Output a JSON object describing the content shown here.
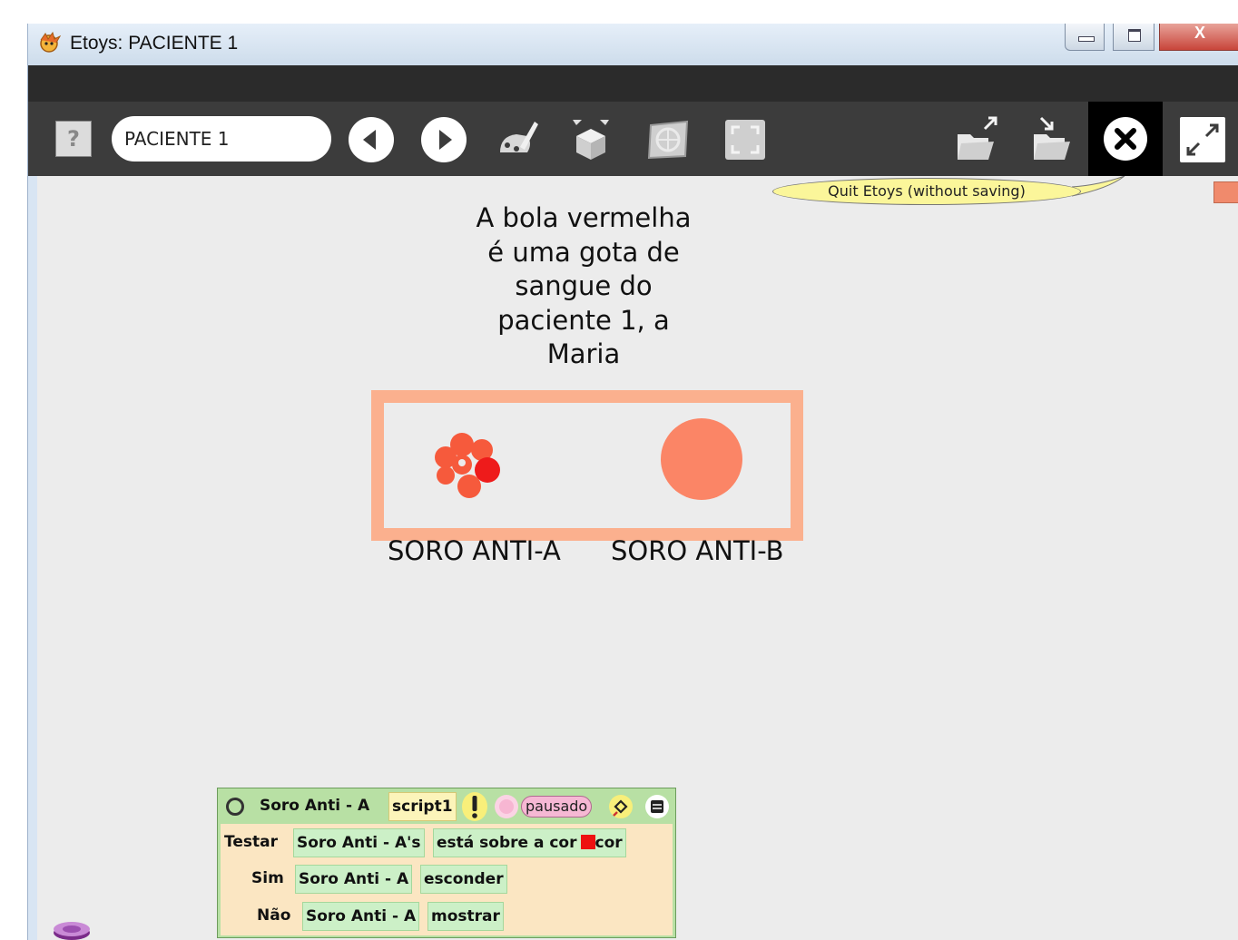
{
  "window": {
    "title": "Etoys: PACIENTE 1",
    "close_glyph": "X"
  },
  "toolbar": {
    "help_label": "?",
    "project_name": "PACIENTE 1",
    "icons": [
      "help-icon",
      "previous-page-icon",
      "next-page-icon",
      "paint-icon",
      "supplies-icon",
      "language-icon",
      "fullscreen-icon",
      "save-project-icon",
      "load-project-icon",
      "quit-icon",
      "zoom-icon"
    ]
  },
  "world": {
    "tooltip": "Quit Etoys (without saving)",
    "description": [
      "A bola vermelha",
      "é uma gota de",
      "sangue do",
      "paciente 1, a",
      "Maria"
    ],
    "serum_a_label": "SORO ANTI-A",
    "serum_b_label": "SORO ANTI-B",
    "colors": {
      "frame": "#fbb08e",
      "serum_ball": "#fb8566",
      "blood_drop_dark": "#ee1b1b",
      "blood_drop_light": "#f65a3c"
    }
  },
  "script": {
    "player": "Soro Anti - A",
    "name": "script1",
    "status": "pausado",
    "test_keyword": "Testar",
    "test_subject": "Soro Anti - A's",
    "test_condition": "está sobre a cor",
    "test_color_label": "cor",
    "test_color": "#ee1111",
    "yes_keyword": "Sim",
    "yes_subject": "Soro Anti - A",
    "yes_command": "esconder",
    "no_keyword": "Não",
    "no_subject": "Soro Anti - A",
    "no_command": "mostrar"
  }
}
